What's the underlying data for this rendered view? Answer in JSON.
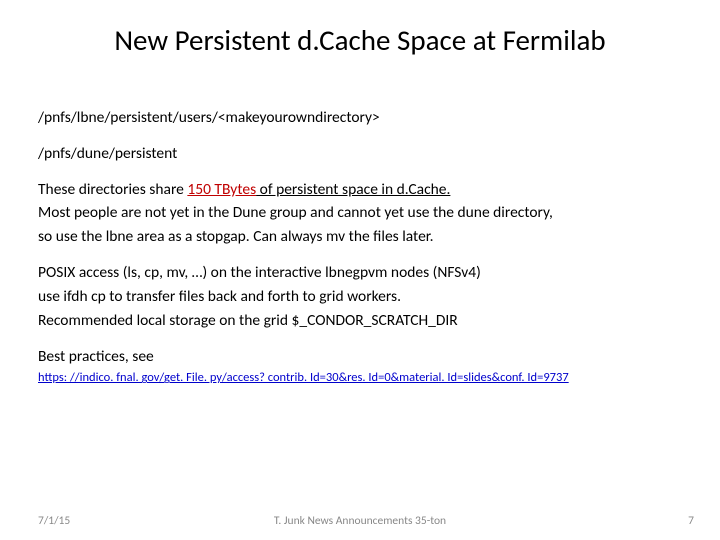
{
  "title": "New Persistent d.Cache Space at Fermilab",
  "path1": "/pnfs/lbne/persistent/users/<makeyourowndirectory>",
  "path2": "/pnfs/dune/persistent",
  "line3_a": "These directories share ",
  "line3_b": "150 TBytes",
  "line3_c": " of persistent space in d.Cache.",
  "line4": "Most people are not yet in the Dune group and cannot yet use the dune directory,",
  "line5": "so use the lbne area as a stopgap. Can always mv the files later.",
  "line6": "POSIX access (ls, cp, mv, …) on the interactive lbnegpvm nodes (NFSv4)",
  "line7": "use ifdh cp to transfer files back and forth to grid workers.",
  "line8": "Recommended local storage on the grid $_CONDOR_SCRATCH_DIR",
  "line9": "Best practices, see",
  "link": "https: //indico. fnal. gov/get. File. py/access? contrib. Id=30&res. Id=0&material. Id=slides&conf. Id=9737",
  "footer": {
    "date": "7/1/15",
    "mid": "T. Junk News Announcements 35-ton",
    "num": "7"
  }
}
